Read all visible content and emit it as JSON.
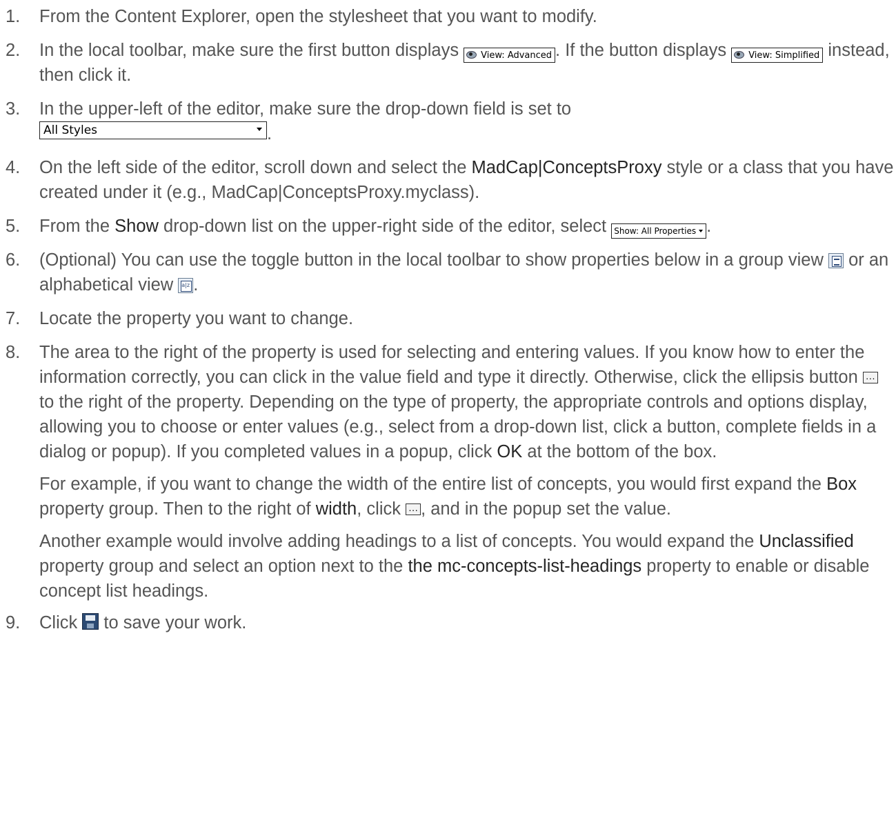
{
  "steps": [
    {
      "number": "1.",
      "text": "From the Content Explorer, open the stylesheet that you want to modify."
    },
    {
      "number": "2.",
      "t1": "In the local toolbar, make sure the first button displays ",
      "btn_advanced": "View: Advanced",
      "t2": ". If the button displays ",
      "btn_simplified": "View: Simplified",
      "t3": " instead, then click it."
    },
    {
      "number": "3.",
      "t1": "In the upper-left of the editor, make sure the drop-down field is set to",
      "select_value": "All Styles",
      "t2": "."
    },
    {
      "number": "4.",
      "t1": "On the left side of the editor, scroll down and select the ",
      "b1": "MadCap|ConceptsProxy",
      "t2": " style or a class that you have created under it (e.g., MadCap|ConceptsProxy.myclass)."
    },
    {
      "number": "5.",
      "t1": "From the ",
      "b1": "Show",
      "t2": " drop-down list on the upper-right side of the editor, select ",
      "show_value": "Show: All Properties",
      "t3": "."
    },
    {
      "number": "6.",
      "t1": "(Optional) You can use the toggle button in the local toolbar to show properties below in a group view ",
      "t2": " or an alphabetical view ",
      "t3": ".",
      "icons": [
        "group-view-icon",
        "alphabetical-view-icon"
      ]
    },
    {
      "number": "7.",
      "text": "Locate the property you want to change."
    },
    {
      "number": "8.",
      "t1": "The area to the right of the property is used for selecting and entering values. If you know how to enter the information correctly, you can click in the value field and type it directly. Otherwise, click the ellipsis button ",
      "t2": " to the right of the property. Depending on the type of property, the appropriate controls and options display, allowing you to choose or enter values (e.g., select from a drop-down list, click a button, complete fields in a dialog or popup). If you completed values in a popup, click ",
      "b1": "OK",
      "t3": " at the bottom of the box.",
      "ex1": {
        "t1": "For example, if you want to change the width of the entire list of concepts, you would first expand the ",
        "b1": "Box",
        "t2": " property group. Then to the right of ",
        "b2": "width",
        "t3": ", click ",
        "t4": ", and in the popup set the value."
      },
      "ex2": {
        "t1": "Another example would involve adding headings to a list of concepts. You would expand the ",
        "b1": "Unclassified",
        "t2": " property group and select an option next to the ",
        "b2": "the mc-concepts-list-headings",
        "t3": " property to enable or disable concept list headings."
      }
    },
    {
      "number": "9.",
      "t1": "Click ",
      "t2": " to save your work.",
      "icons": [
        "save-icon"
      ]
    }
  ],
  "colors": {
    "text": "#555555",
    "emphasis": "#262626"
  }
}
